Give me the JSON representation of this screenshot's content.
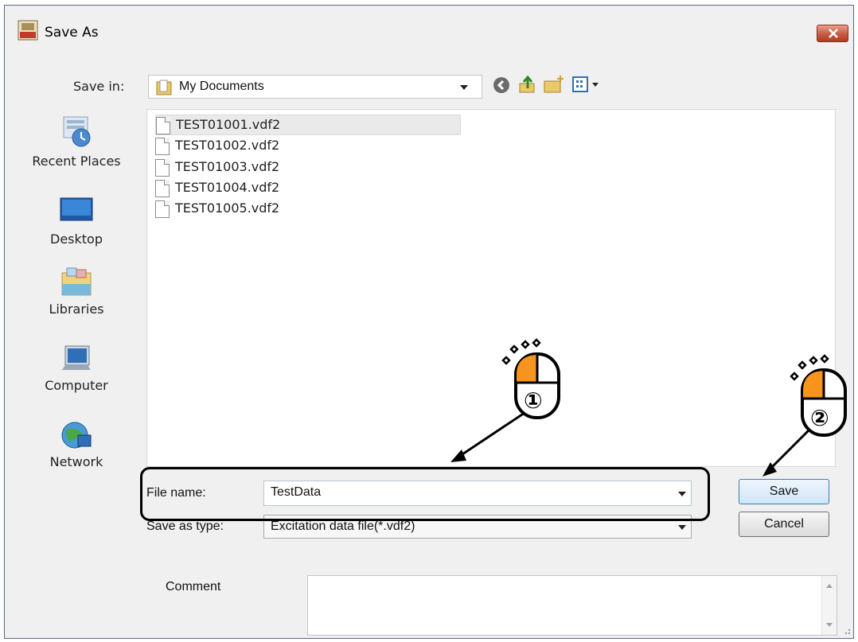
{
  "window": {
    "title": "Save As",
    "app_icon": "app-logo-icon",
    "close_icon": "close-icon"
  },
  "savein": {
    "label": "Save in:",
    "value": "My Documents",
    "toolbar_icons": [
      "back-icon",
      "up-folder-icon",
      "new-folder-icon",
      "view-menu-icon"
    ]
  },
  "places": [
    {
      "label": "Recent Places",
      "icon": "recent-places-icon"
    },
    {
      "label": "Desktop",
      "icon": "desktop-icon"
    },
    {
      "label": "Libraries",
      "icon": "libraries-icon"
    },
    {
      "label": "Computer",
      "icon": "computer-icon"
    },
    {
      "label": "Network",
      "icon": "network-icon"
    }
  ],
  "files": [
    {
      "name": "TEST01001.vdf2",
      "selected": true
    },
    {
      "name": "TEST01002.vdf2",
      "selected": false
    },
    {
      "name": "TEST01003.vdf2",
      "selected": false
    },
    {
      "name": "TEST01004.vdf2",
      "selected": false
    },
    {
      "name": "TEST01005.vdf2",
      "selected": false
    }
  ],
  "filename": {
    "label": "File name:",
    "value": "TestData"
  },
  "savetype": {
    "label": "Save as type:",
    "value": "Excitation data file(*.vdf2)"
  },
  "buttons": {
    "save": "Save",
    "cancel": "Cancel"
  },
  "comment": {
    "label": "Comment",
    "value": ""
  },
  "annotations": [
    {
      "number": "①",
      "icon": "mouse-click-icon",
      "accent": "#f7941d"
    },
    {
      "number": "②",
      "icon": "mouse-click-icon",
      "accent": "#f7941d"
    }
  ],
  "colors": {
    "accent": "#f7941d",
    "close": "#c85a40",
    "save_border": "#3c7fb1"
  }
}
